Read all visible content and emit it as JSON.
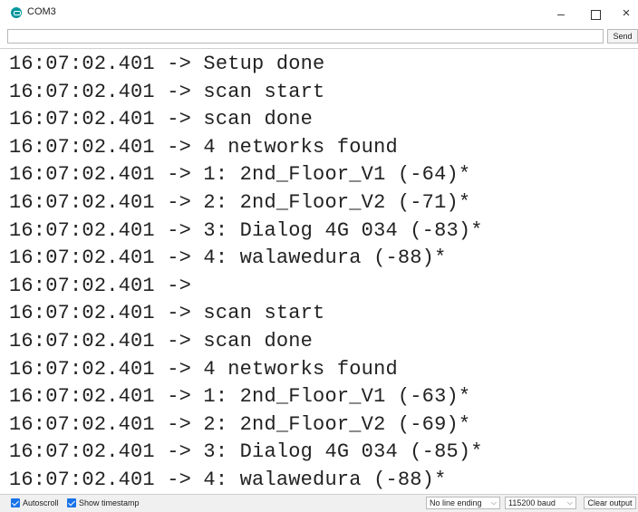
{
  "window": {
    "title": "COM3",
    "minimize_glyph": "–",
    "close_glyph": "×",
    "icon": "arduino-icon"
  },
  "send_bar": {
    "input_value": "",
    "send_label": "Send"
  },
  "output": {
    "lines": [
      "16:07:02.401 -> Setup done",
      "16:07:02.401 -> scan start",
      "16:07:02.401 -> scan done",
      "16:07:02.401 -> 4 networks found",
      "16:07:02.401 -> 1: 2nd_Floor_V1 (-64)*",
      "16:07:02.401 -> 2: 2nd_Floor_V2 (-71)*",
      "16:07:02.401 -> 3: Dialog 4G 034 (-83)*",
      "16:07:02.401 -> 4: walawedura (-88)*",
      "16:07:02.401 ->",
      "16:07:02.401 -> scan start",
      "16:07:02.401 -> scan done",
      "16:07:02.401 -> 4 networks found",
      "16:07:02.401 -> 1: 2nd_Floor_V1 (-63)*",
      "16:07:02.401 -> 2: 2nd_Floor_V2 (-69)*",
      "16:07:02.401 -> 3: Dialog 4G 034 (-85)*",
      "16:07:02.401 -> 4: walawedura (-88)*"
    ]
  },
  "bottom_bar": {
    "autoscroll_label": "Autoscroll",
    "autoscroll_checked": true,
    "timestamp_label": "Show timestamp",
    "timestamp_checked": true,
    "line_ending": "No line ending",
    "baud": "115200 baud",
    "clear_label": "Clear output",
    "accent_color": "#1a73e8"
  }
}
